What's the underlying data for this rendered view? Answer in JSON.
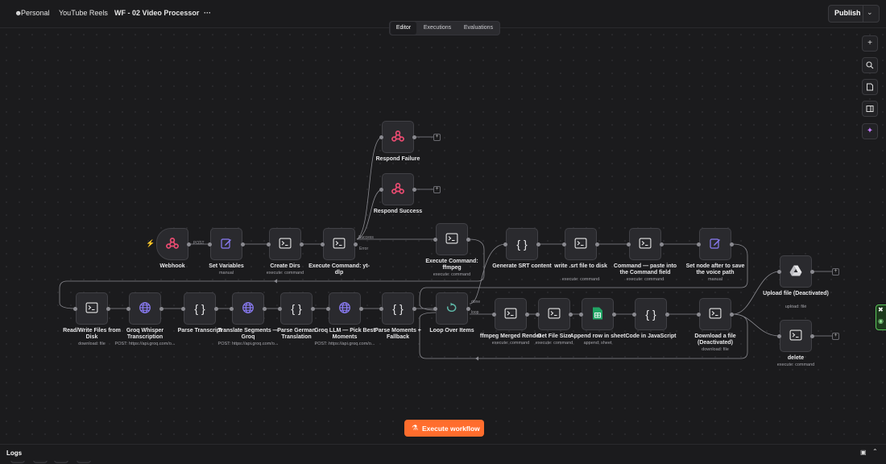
{
  "breadcrumb": {
    "project": "Personal",
    "folder": "YouTube Reels",
    "workflow": "WF - 02 Video Processor",
    "more": "···"
  },
  "header": {
    "publish": "Publish"
  },
  "tabs": [
    "Editor",
    "Executions",
    "Evaluations"
  ],
  "nodes": [
    {
      "label": "Webhook",
      "sub": ""
    },
    {
      "label": "Set Variables",
      "sub": "manual"
    },
    {
      "label": "Create Dirs",
      "sub": "execute: command"
    },
    {
      "label": "Execute Command: yt-dlp",
      "sub": ""
    },
    {
      "label": "Respond Failure",
      "sub": ""
    },
    {
      "label": "Respond Success",
      "sub": ""
    },
    {
      "label": "Execute Command: ffmpeg",
      "sub": "execute: command"
    },
    {
      "label": "Generate SRT content",
      "sub": ""
    },
    {
      "label": "write .srt file to disk",
      "sub": "execute: command"
    },
    {
      "label": "Command — paste into the Command field",
      "sub": "execute: command"
    },
    {
      "label": "Set node after to save the voice path",
      "sub": "manual"
    },
    {
      "label": "Read/Write Files from Disk",
      "sub": "download: file"
    },
    {
      "label": "Groq Whisper Transcription",
      "sub": "POST: https://api.groq.com/o..."
    },
    {
      "label": "Parse Transcript",
      "sub": ""
    },
    {
      "label": "Translate Segments — Groq",
      "sub": "POST: https://api.groq.com/o..."
    },
    {
      "label": "Parse German Translation",
      "sub": ""
    },
    {
      "label": "Groq LLM — Pick Best Moments",
      "sub": "POST: https://api.groq.com/o..."
    },
    {
      "label": "Parse Moments + Fallback",
      "sub": ""
    },
    {
      "label": "Loop Over Items",
      "sub": ""
    },
    {
      "label": "ffmpeg Merged Render",
      "sub": "execute: command"
    },
    {
      "label": "Get File Size",
      "sub": "execute: command"
    },
    {
      "label": "Append row in sheet",
      "sub": "append: sheet"
    },
    {
      "label": "Code in JavaScript",
      "sub": ""
    },
    {
      "label": "Download a file (Deactivated)",
      "sub": "download: file"
    },
    {
      "label": "Upload file (Deactivated)",
      "sub": "upload: file"
    },
    {
      "label": "delete",
      "sub": "execute: command"
    }
  ],
  "edge_labels": {
    "post": "POST",
    "success": "Success",
    "error": "Error",
    "done": "done",
    "loop": "loop"
  },
  "toolbar": {
    "execute": "Execute workflow",
    "logs": "Logs"
  },
  "icons": {
    "node_types": [
      "webhook-icon",
      "pencil-icon",
      "terminal-icon",
      "terminal-icon",
      "webhook-icon",
      "webhook-icon",
      "terminal-icon",
      "code-braces-icon",
      "terminal-icon",
      "terminal-icon",
      "pencil-icon",
      "terminal-icon",
      "globe-icon",
      "code-braces-icon",
      "globe-icon",
      "code-braces-icon",
      "globe-icon",
      "code-braces-icon",
      "loop-icon",
      "terminal-icon",
      "terminal-icon",
      "sheets-icon",
      "code-braces-icon",
      "terminal-icon",
      "drive-icon",
      "terminal-icon"
    ],
    "right_tools": [
      "plus-icon",
      "search-icon",
      "sticky-note-icon",
      "panel-icon",
      "sparkle-icon"
    ],
    "bottom_tools": [
      "fit-view-icon",
      "zoom-in-icon",
      "zoom-out-icon",
      "cursor-icon"
    ]
  },
  "colors": {
    "accent": "#ff6d2d",
    "webhook": "#ea4b71",
    "code": "#ef9a3c",
    "globe": "#8b7cf6",
    "pencil": "#8b7cf6",
    "loop": "#5fb8a8",
    "sheets": "#21a464",
    "edge": "#8a8a90"
  }
}
